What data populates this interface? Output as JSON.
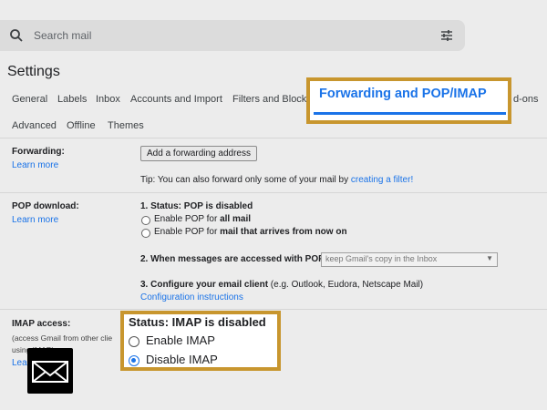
{
  "search": {
    "placeholder": "Search mail",
    "icon": "search-icon",
    "filter_icon": "filter-options-icon"
  },
  "page": {
    "title": "Settings"
  },
  "tabs": [
    {
      "label": "General"
    },
    {
      "label": "Labels"
    },
    {
      "label": "Inbox"
    },
    {
      "label": "Accounts and Import"
    },
    {
      "label": "Filters and Blocke"
    },
    {
      "label": "Forwarding and POP/IMAP",
      "active": true
    },
    {
      "label": "d-ons"
    },
    {
      "label": "Advanced"
    },
    {
      "label": "Offline"
    },
    {
      "label": "Themes"
    }
  ],
  "forwarding": {
    "label": "Forwarding:",
    "learn_more": "Learn more",
    "button": "Add a forwarding address",
    "tip_text": "Tip: You can also forward only some of your mail by ",
    "tip_link": "creating a filter!"
  },
  "pop": {
    "label": "POP download:",
    "learn_more": "Learn more",
    "status_prefix": "1. Status: ",
    "status": "POP is disabled",
    "opt1_text": "Enable POP for ",
    "opt1_bold": "all mail",
    "opt2_text": "Enable POP for ",
    "opt2_bold": "mail that arrives from now on",
    "step2_label": "2. When messages are accessed with POP",
    "step2_select": "keep Gmail's copy in the Inbox",
    "step3_label": "3. Configure your email client",
    "step3_text": " (e.g. Outlook, Eudora, Netscape Mail)",
    "step3_link": "Configuration instructions"
  },
  "imap": {
    "label": "IMAP access:",
    "sub1": "(access Gmail from other clie",
    "sub2": "using IMAP)",
    "learn_more": "Lea",
    "status": "Status: IMAP is disabled",
    "enable": "Enable IMAP",
    "disable": "Disable IMAP",
    "selected": "Disable IMAP"
  },
  "overlay": {
    "icon": "envelope-icon"
  },
  "colors": {
    "accent": "#1a73e8",
    "highlight_border": "#c8962e",
    "background": "#ececec"
  }
}
